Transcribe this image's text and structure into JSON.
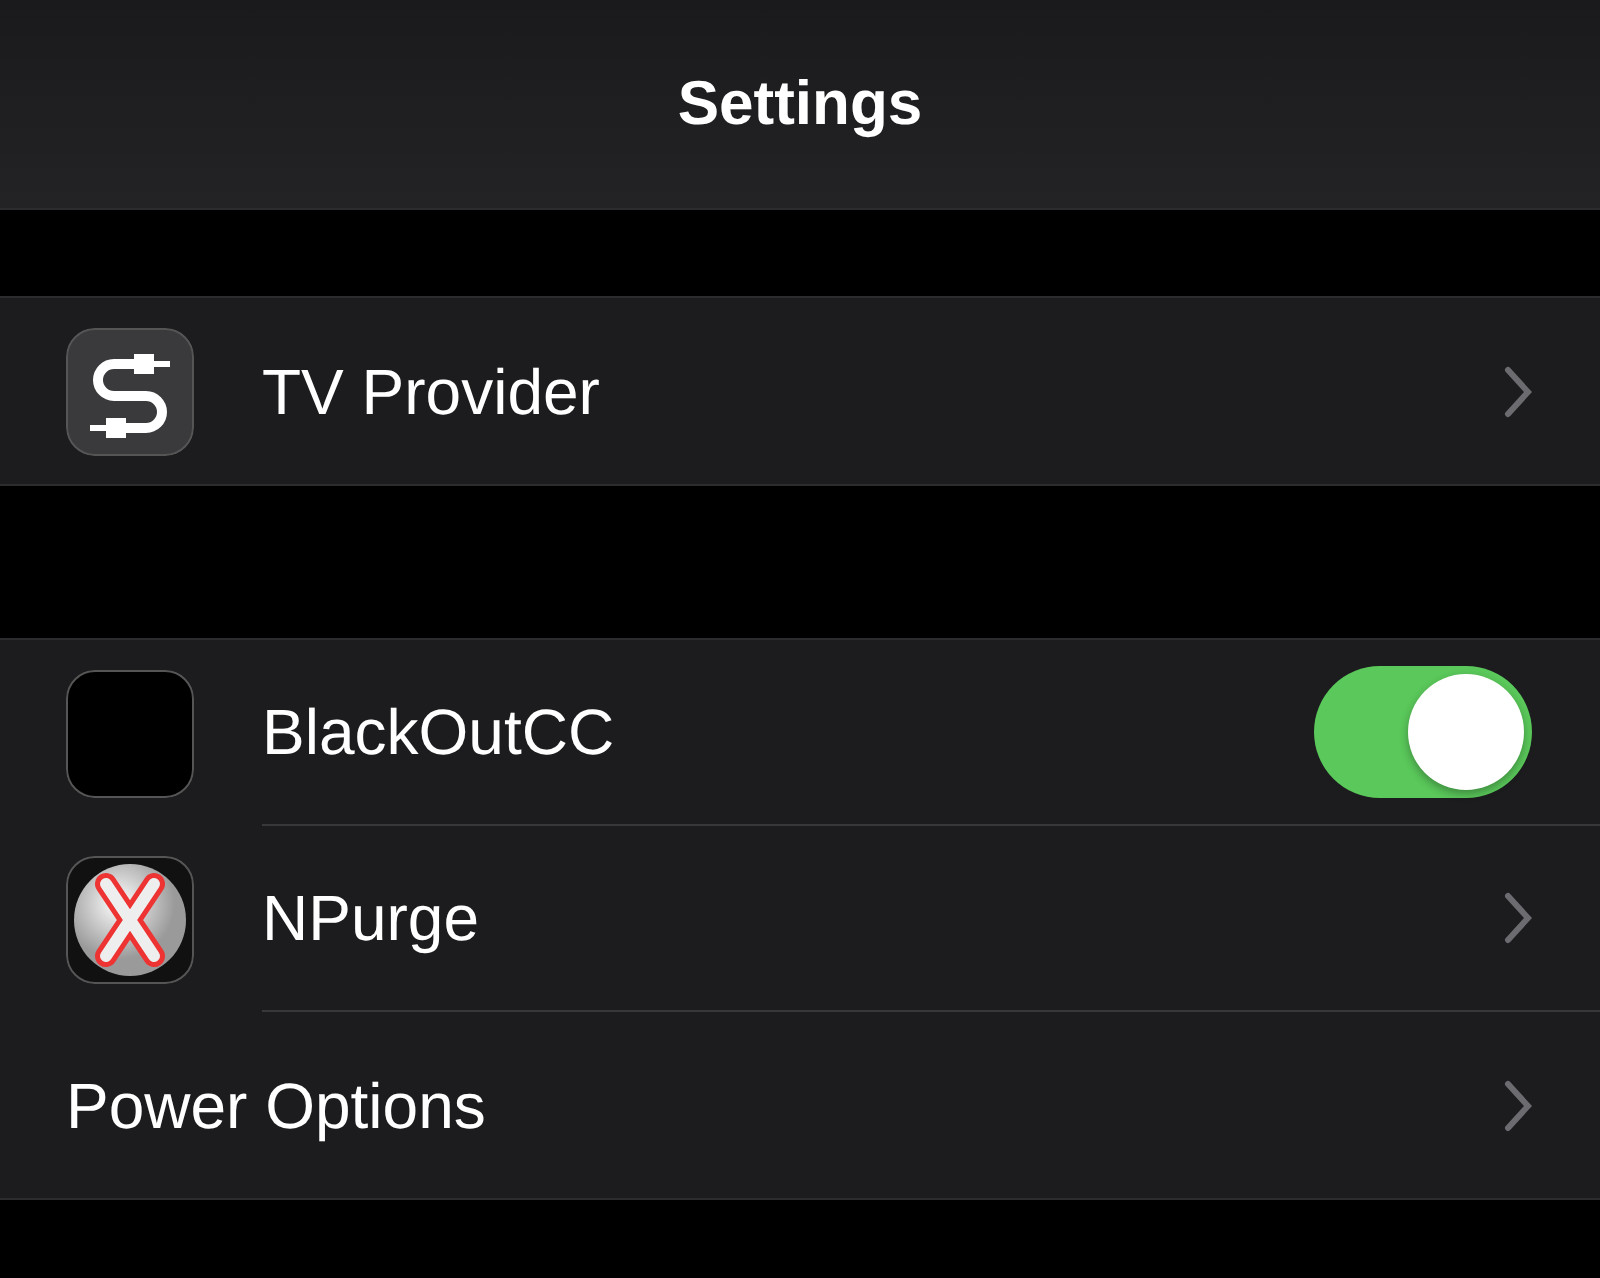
{
  "title": "Settings",
  "groups": [
    {
      "rows": [
        {
          "label": "TV Provider",
          "kind": "link"
        }
      ]
    },
    {
      "rows": [
        {
          "label": "BlackOutCC",
          "kind": "toggle",
          "on": true
        },
        {
          "label": "NPurge",
          "kind": "link"
        },
        {
          "label": "Power Options",
          "kind": "link"
        }
      ]
    }
  ]
}
